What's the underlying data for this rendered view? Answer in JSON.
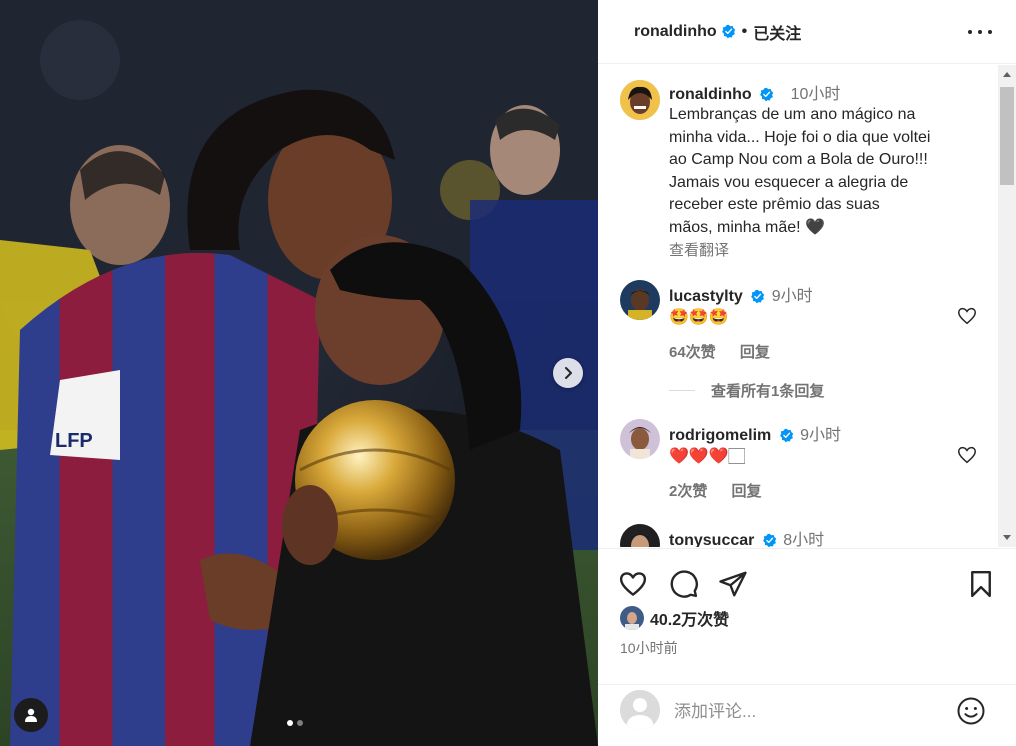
{
  "header": {
    "username": "ronaldinho",
    "follow_status": "已关注"
  },
  "caption": {
    "username": "ronaldinho",
    "time": "10小时",
    "lines": [
      "Lembranças de um ano mágico na",
      "minha vida... Hoje foi o dia que voltei",
      "ao Camp Nou com a Bola de Ouro!!!",
      "Jamais vou esquecer a alegria de",
      "receber este prêmio das suas",
      "mãos, minha mãe! 🖤"
    ],
    "translate": "查看翻译"
  },
  "comments": [
    {
      "username": "lucastylty",
      "time": "9小时",
      "text": "🤩🤩🤩",
      "likes": "64次赞",
      "reply": "回复",
      "view_replies": "查看所有1条回复"
    },
    {
      "username": "rodrigomelim",
      "time": "9小时",
      "text": "❤️❤️❤️🏻",
      "likes": "2次赞",
      "reply": "回复"
    },
    {
      "username": "tonysuccar",
      "time": "8小时"
    }
  ],
  "actions": {
    "likes_count": "40.2万次赞",
    "posted_time": "10小时前"
  },
  "add_comment": {
    "placeholder": "添加评论..."
  },
  "carousel": {
    "current": 1,
    "total": 2
  },
  "colors": {
    "verified": "#0095f6",
    "muted": "#737373",
    "text": "#262626"
  }
}
